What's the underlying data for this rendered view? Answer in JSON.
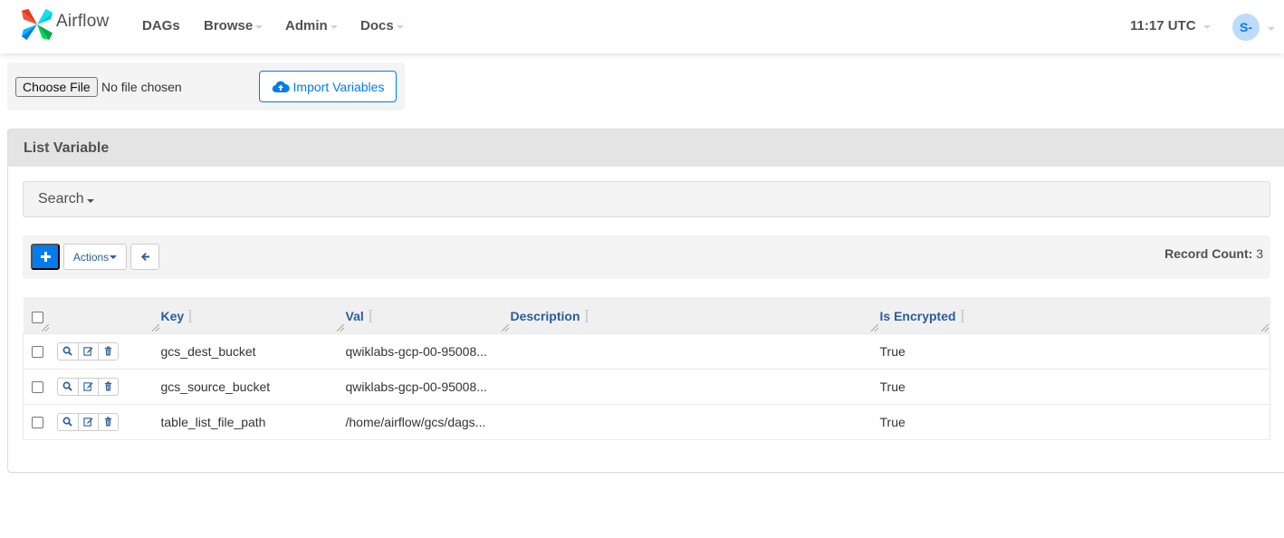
{
  "navbar": {
    "brand": "Airflow",
    "items": [
      {
        "label": "DAGs",
        "dropdown": false
      },
      {
        "label": "Browse",
        "dropdown": true
      },
      {
        "label": "Admin",
        "dropdown": true
      },
      {
        "label": "Docs",
        "dropdown": true
      }
    ],
    "clock": "11:17 UTC",
    "user_initials": "S-"
  },
  "import": {
    "choose_file_label": "Choose File",
    "file_status": "No file chosen",
    "import_button": "Import Variables"
  },
  "list": {
    "title": "List Variable",
    "search_label": "Search",
    "add_button": "+",
    "actions_button": "Actions",
    "record_count_label": "Record Count:",
    "record_count": "3",
    "columns": [
      "Key",
      "Val",
      "Description",
      "Is Encrypted"
    ],
    "rows": [
      {
        "key": "gcs_dest_bucket",
        "val": "qwiklabs-gcp-00-95008...",
        "description": "",
        "is_encrypted": "True"
      },
      {
        "key": "gcs_source_bucket",
        "val": "qwiklabs-gcp-00-95008...",
        "description": "",
        "is_encrypted": "True"
      },
      {
        "key": "table_list_file_path",
        "val": "/home/airflow/gcs/dags...",
        "description": "",
        "is_encrypted": "True"
      }
    ]
  },
  "colors": {
    "accent": "#017cee",
    "header_link": "#2a5d9a",
    "nav_text": "#51504f"
  }
}
